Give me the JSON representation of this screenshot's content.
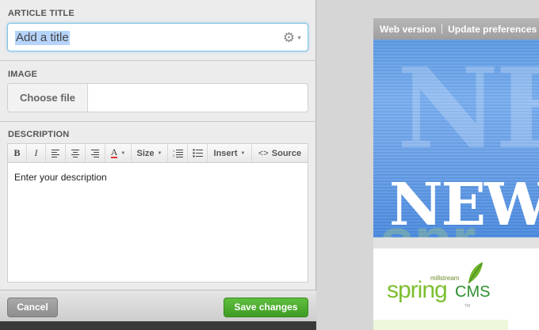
{
  "form": {
    "title_section": {
      "label": "ARTICLE TITLE",
      "placeholder": "Add a title"
    },
    "image_section": {
      "label": "IMAGE",
      "choose_file": "Choose file"
    },
    "description_section": {
      "label": "DESCRIPTION",
      "toolbar": {
        "bold": "B",
        "italic": "I",
        "font_color": "A",
        "size": "Size",
        "insert": "Insert",
        "source": "Source"
      },
      "placeholder": "Enter your description"
    },
    "footer": {
      "cancel": "Cancel",
      "save": "Save changes"
    }
  },
  "preview": {
    "nav": {
      "web_version": "Web version",
      "update_preferences": "Update preferences"
    },
    "hero": {
      "ghost_text": "NE",
      "headline": "NEW",
      "watermark": "spr"
    },
    "logo": {
      "brand_small": "millstream",
      "brand_main": "spring",
      "brand_suffix": "CMS",
      "trademark": "TM"
    }
  },
  "colors": {
    "save_green": "#4aa82c",
    "focus_blue": "#7ec3e6",
    "hero_blue": "#6ea4ea",
    "logo_green": "#7dbf2f"
  }
}
